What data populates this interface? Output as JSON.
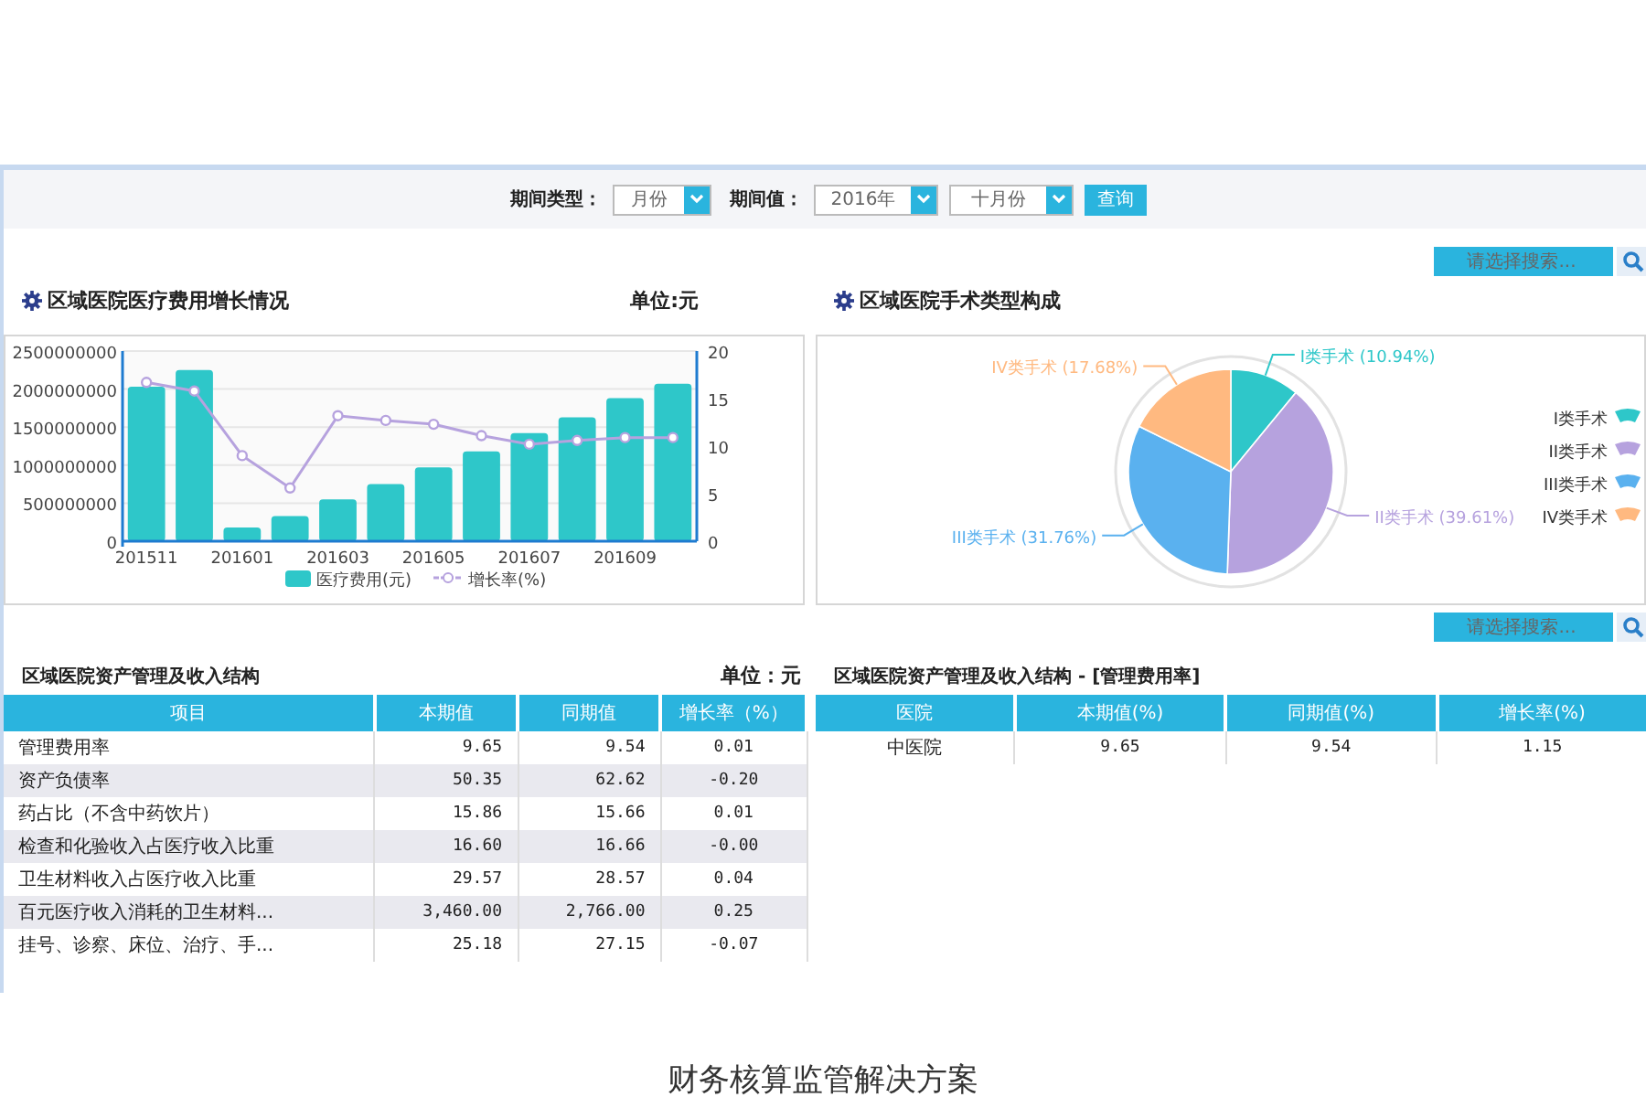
{
  "filter_bar": {
    "period_type_label": "期间类型：",
    "period_type": "月份",
    "period_value_label": "期间值：",
    "year": "2016年",
    "month": "十月份",
    "query_button": "查询"
  },
  "cost_panel": {
    "title": "区域医院医疗费用增长情况",
    "unit": "单位:元",
    "chart_data": {
      "type": "bar",
      "categories": [
        "201511",
        null,
        "201601",
        null,
        "201603",
        null,
        "201605",
        null,
        "201607",
        null,
        "201609",
        null
      ],
      "series": [
        {
          "name": "医疗费用(元)",
          "type": "bar",
          "color": "#2ec7c9",
          "values": [
            2030000000,
            2250000000,
            180000000,
            330000000,
            550000000,
            750000000,
            970000000,
            1180000000,
            1420000000,
            1630000000,
            1880000000,
            2070000000
          ]
        },
        {
          "name": "增长率(%)",
          "type": "line",
          "axis": "y2",
          "marker": "circle",
          "color": "#b6a2de",
          "values": [
            16.7,
            15.8,
            9.0,
            5.6,
            13.2,
            12.7,
            12.3,
            11.1,
            10.2,
            10.6,
            10.9,
            10.9
          ]
        }
      ],
      "grid": true,
      "legend": "bottom",
      "ylim": [
        0,
        2500000000
      ],
      "yticks": [
        0,
        500000000,
        1000000000,
        1500000000,
        2000000000,
        2500000000
      ],
      "y2lim": [
        0,
        20
      ],
      "y2ticks": [
        0,
        5,
        10,
        15,
        20
      ]
    }
  },
  "surgery_panel": {
    "search_placeholder": "请选择搜索...",
    "title": "区域医院手术类型构成",
    "chart_data": {
      "type": "pie",
      "categories": [
        "I类手术",
        "II类手术",
        "III类手术",
        "IV类手术"
      ],
      "series": [
        {
          "values": [
            10.94,
            39.61,
            31.76,
            17.68
          ]
        }
      ],
      "colors": [
        "#2ec7c9",
        "#b6a2de",
        "#5ab1ef",
        "#ffb980"
      ],
      "legend": "right",
      "value_labels": [
        "(10.94%)",
        "(39.61%)",
        "(31.76%)",
        "(17.68%)"
      ]
    }
  },
  "asset_table": {
    "title": "区域医院资产管理及收入结构",
    "unit": "单位：元",
    "columns": [
      "项目",
      "本期值",
      "同期值",
      "增长率（%）"
    ],
    "rows": [
      [
        "管理费用率",
        "9.65",
        "9.54",
        "0.01"
      ],
      [
        "资产负债率",
        "50.35",
        "62.62",
        "-0.20"
      ],
      [
        "药占比（不含中药饮片）",
        "15.86",
        "15.66",
        "0.01"
      ],
      [
        "检查和化验收入占医疗收入比重",
        "16.60",
        "16.66",
        "-0.00"
      ],
      [
        "卫生材料收入占医疗收入比重",
        "29.57",
        "28.57",
        "0.04"
      ],
      [
        "百元医疗收入消耗的卫生材料...",
        "3,460.00",
        "2,766.00",
        "0.25"
      ],
      [
        "挂号、诊察、床位、治疗、手...",
        "25.18",
        "27.15",
        "-0.07"
      ]
    ]
  },
  "detail_table": {
    "search_placeholder": "请选择搜索...",
    "title": "区域医院资产管理及收入结构 - [管理费用率]",
    "columns": [
      "医院",
      "本期值(%)",
      "同期值(%)",
      "增长率(%)"
    ],
    "rows": [
      [
        "中医院",
        "9.65",
        "9.54",
        "1.15"
      ]
    ]
  },
  "caption": "财务核算监管解决方案"
}
